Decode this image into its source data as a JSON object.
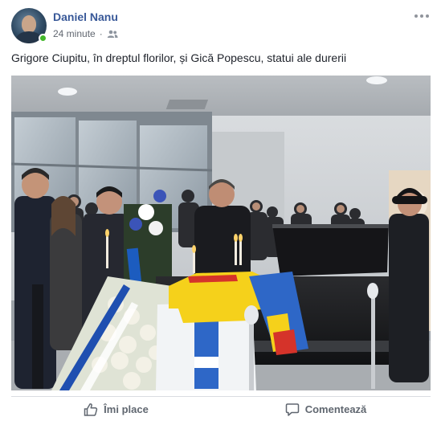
{
  "post": {
    "author": "Daniel Nanu",
    "time": "24 minute",
    "separator": "·",
    "audience_icon": "friends-icon",
    "text": "Grigore Ciupitu, în dreptul florilor, și Gică Popescu, statui ale durerii"
  },
  "actions": {
    "like_label": "Îmi place",
    "like_icon": "thumbs-up-icon",
    "comment_label": "Comentează",
    "comment_icon": "speech-bubble-icon"
  },
  "colors": {
    "name_link": "#385898",
    "meta_text": "#616770",
    "online": "#42b72a",
    "action_text": "#606770",
    "divider": "#dadde1"
  }
}
